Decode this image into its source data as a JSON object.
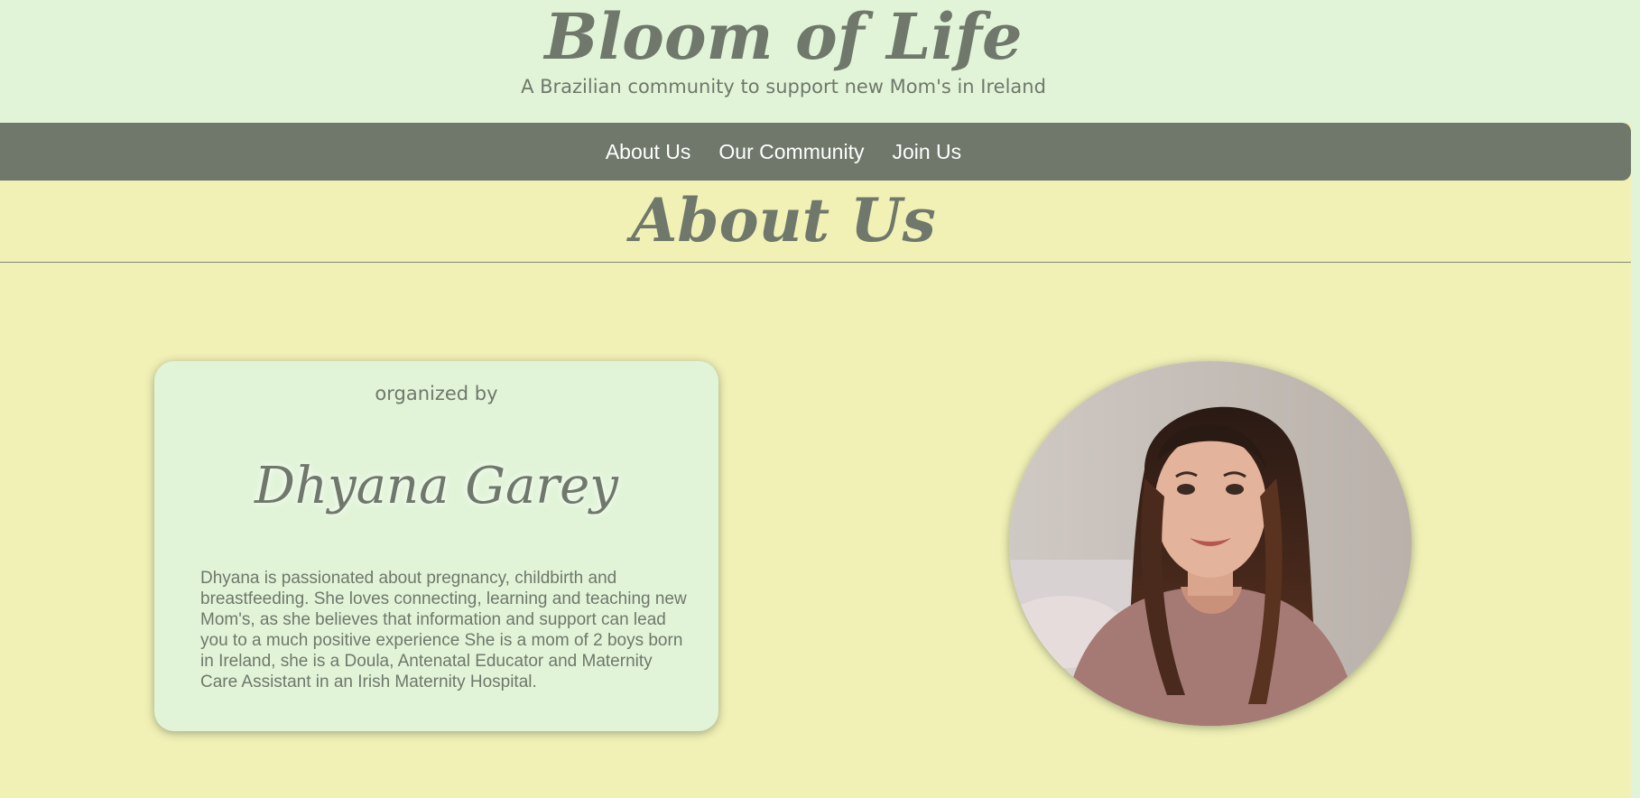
{
  "header": {
    "site_title": "Bloom of Life",
    "tagline": "A Brazilian community to support new Mom's in Ireland"
  },
  "nav": {
    "items": [
      {
        "label": "About Us"
      },
      {
        "label": "Our Community"
      },
      {
        "label": "Join Us"
      }
    ]
  },
  "main": {
    "heading": "About Us",
    "card": {
      "organized_label": "organized by",
      "name": "Dhyana Garey",
      "bio": "Dhyana is passionated about pregnancy, childbirth and breastfeeding. She loves connecting, learning and teaching new Mom's, as she believes that information and support can lead you to a much positive experience She is a mom of 2 boys born in Ireland, she is a Doula, Antenatal Educator and Maternity Care Assistant in an Irish Maternity Hospital."
    }
  },
  "colors": {
    "page_background": "#f1f1b6",
    "header_background": "#e1f4d8",
    "nav_background": "#6f786b",
    "text": "#6f786b",
    "nav_text": "#ffffff"
  }
}
